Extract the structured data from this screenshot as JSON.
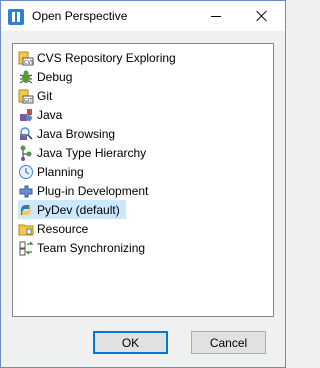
{
  "window": {
    "title": "Open Perspective"
  },
  "perspectives": [
    {
      "label": "CVS Repository Exploring",
      "icon": "cvs-repository-icon"
    },
    {
      "label": "Debug",
      "icon": "debug-icon"
    },
    {
      "label": "Git",
      "icon": "git-icon"
    },
    {
      "label": "Java",
      "icon": "java-icon"
    },
    {
      "label": "Java Browsing",
      "icon": "java-browsing-icon"
    },
    {
      "label": "Java Type Hierarchy",
      "icon": "java-type-hierarchy-icon"
    },
    {
      "label": "Planning",
      "icon": "planning-icon"
    },
    {
      "label": "Plug-in Development",
      "icon": "plugin-development-icon"
    },
    {
      "label": "PyDev (default)",
      "icon": "pydev-icon",
      "selected": true
    },
    {
      "label": "Resource",
      "icon": "resource-icon"
    },
    {
      "label": "Team Synchronizing",
      "icon": "team-sync-icon"
    }
  ],
  "buttons": {
    "ok": "OK",
    "cancel": "Cancel"
  },
  "colors": {
    "selection": "#cce8ff",
    "accent": "#0078d7"
  }
}
